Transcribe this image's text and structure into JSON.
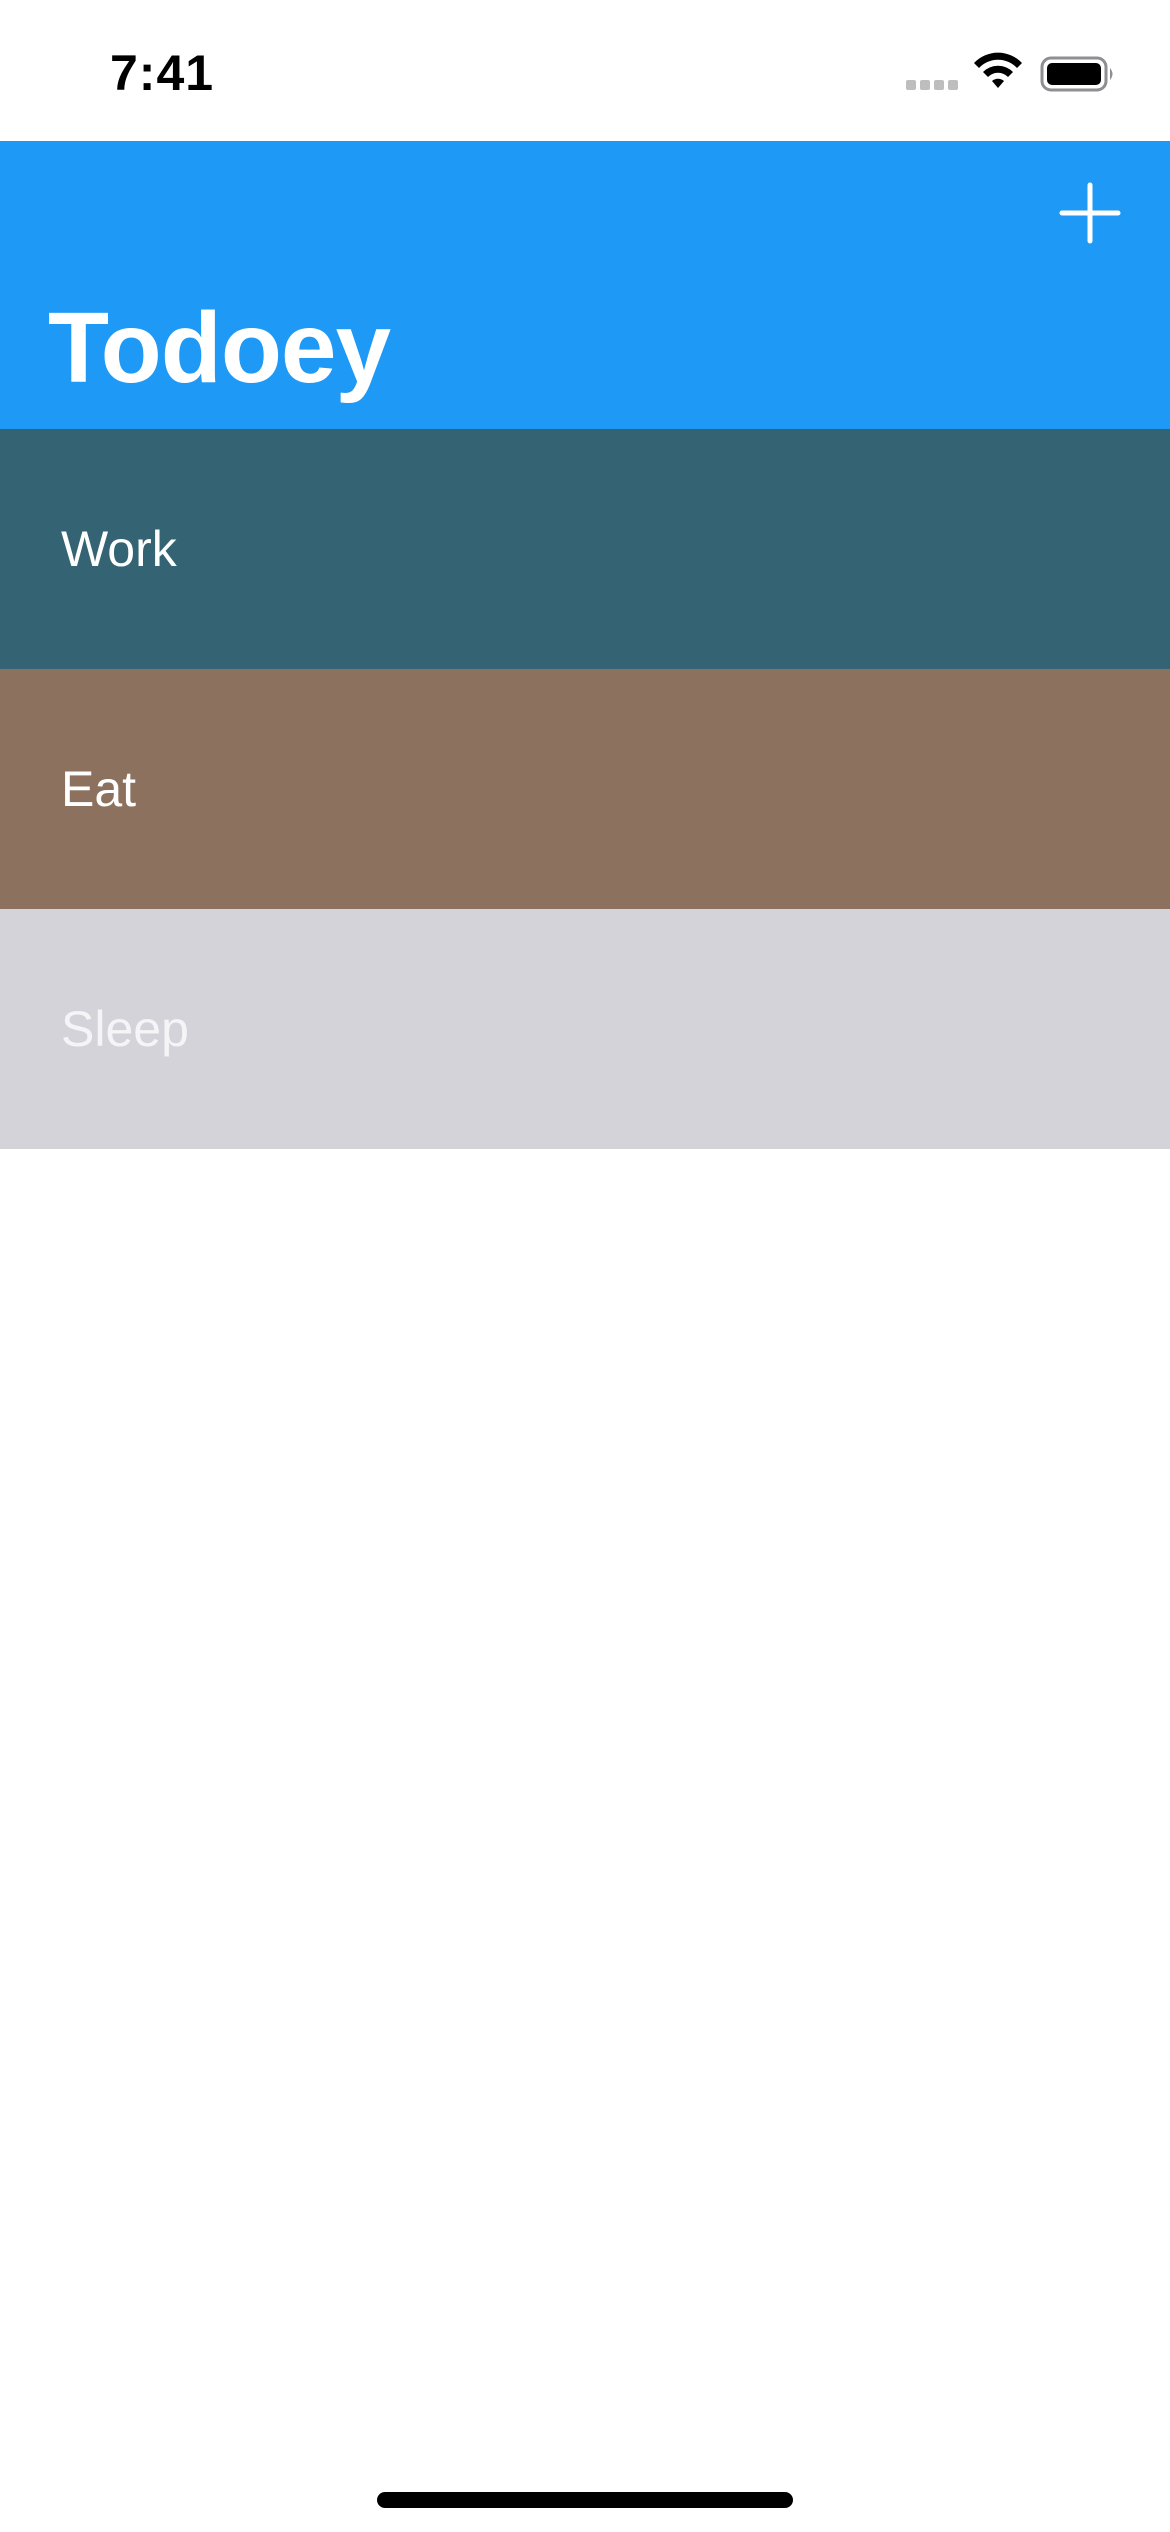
{
  "status_bar": {
    "time": "7:41",
    "icons": [
      "cellular-signal-icon",
      "wifi-icon",
      "battery-icon"
    ]
  },
  "nav_bar": {
    "title": "Todoey",
    "add_icon": "plus-icon",
    "background_color": "#1E99F5"
  },
  "categories": [
    {
      "name": "Work",
      "background_color": "#346473",
      "text_color": "#FFFFFF"
    },
    {
      "name": "Eat",
      "background_color": "#8C725E",
      "text_color": "#FFFFFF"
    },
    {
      "name": "Sleep",
      "background_color": "#D4D3D9",
      "text_color": "#F5F5F7"
    }
  ]
}
